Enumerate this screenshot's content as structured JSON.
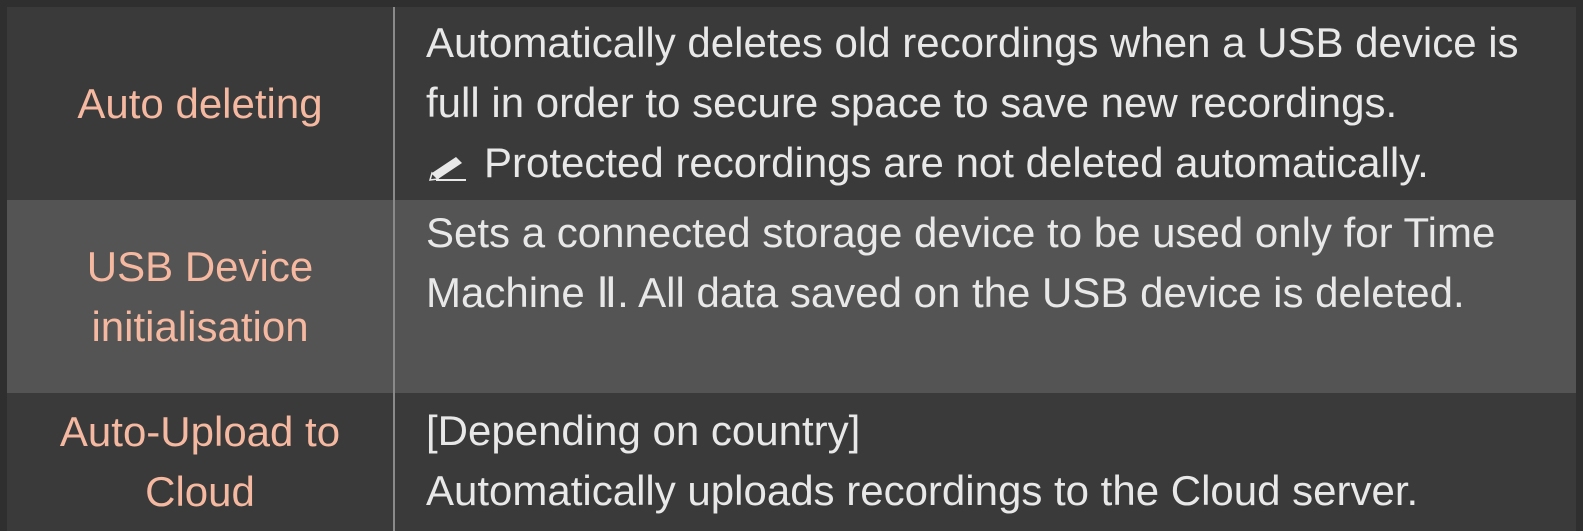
{
  "rows": [
    {
      "label": "Auto deleting",
      "description": "Automatically deletes old recordings when a USB device is full in order to secure space to save new recordings.",
      "note": "Protected recordings are not deleted automatically."
    },
    {
      "label": "USB Device initialisation",
      "description": "Sets a connected storage device to be used only for Time Machine Ⅱ. All data saved on the USB device is deleted."
    },
    {
      "label": "Auto-Upload to Cloud",
      "condition": "[Depending on country]",
      "description": "Automatically uploads recordings to the Cloud server."
    }
  ],
  "icons": {
    "note": "pencil-note-icon"
  },
  "colors": {
    "background": "#2f2f2f",
    "row_dark": "#3a3a3a",
    "row_light": "#545454",
    "label_text": "#f5b8a0",
    "body_text": "#e8e8e8"
  }
}
